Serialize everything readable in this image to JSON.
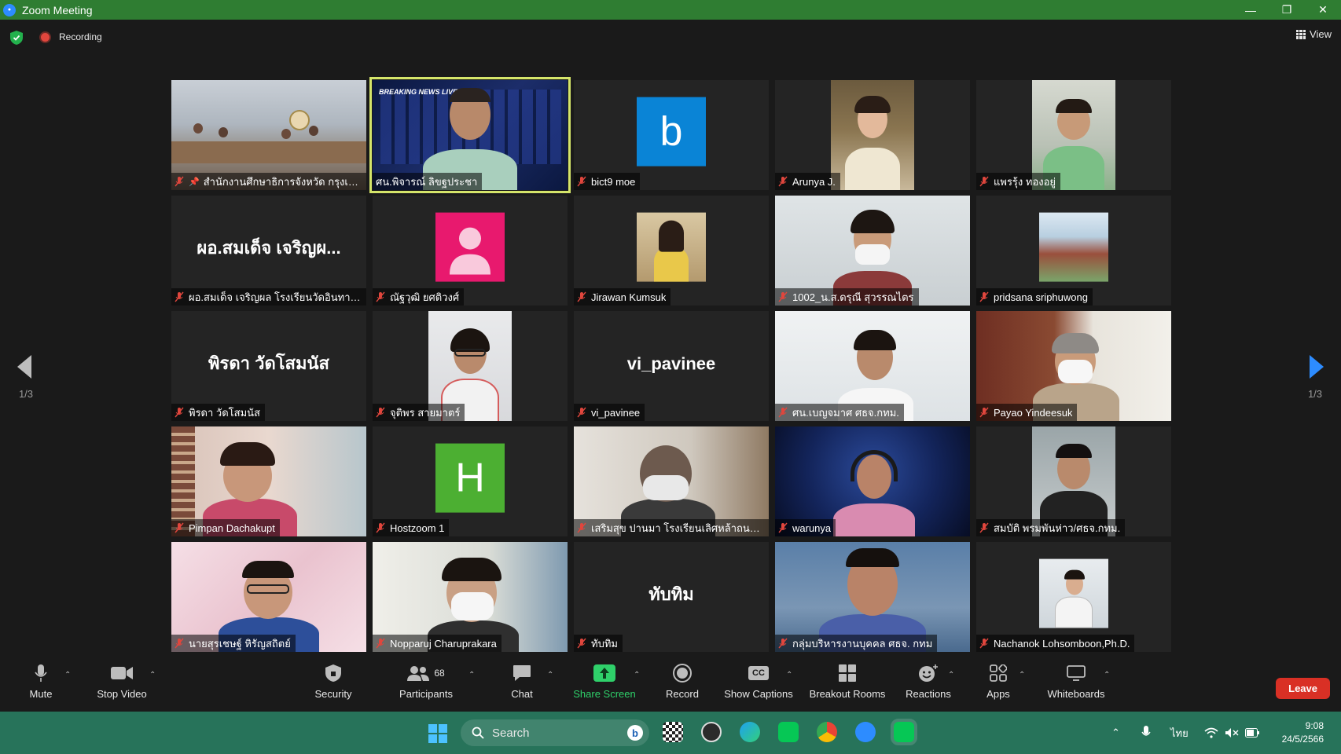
{
  "window": {
    "title": "Zoom Meeting"
  },
  "topbar": {
    "recording_label": "Recording",
    "view_label": "View"
  },
  "pagination": {
    "left_indicator": "1/3",
    "right_indicator": "1/3"
  },
  "tiles": [
    {
      "name": "สำนักงานศึกษาธิการจังหวัด กรุงเทพ...",
      "type": "video",
      "pinned": true
    },
    {
      "name": "ศน.พิจารณ์ ลิขฐประชา",
      "type": "video",
      "active": true,
      "overlay_text": "BREAKING NEWS LIVE"
    },
    {
      "name": "bict9 moe",
      "type": "avatar",
      "avatar_letter": "b",
      "avatar_color": "#0a84d6"
    },
    {
      "name": "Arunya J.",
      "type": "video"
    },
    {
      "name": "แพรรุ้ง ทองอยู่",
      "type": "video"
    },
    {
      "name": "ผอ.สมเด็จ เจริญผล โรงเรียนวัดอินทาราม",
      "type": "text",
      "display_text": "ผอ.สมเด็จ เจริญผ..."
    },
    {
      "name": "ณัฐวุฒิ ยศติวงศ์",
      "type": "avatar-person",
      "avatar_color": "#e8196e"
    },
    {
      "name": "Jirawan Kumsuk",
      "type": "video"
    },
    {
      "name": "1002_น.ส.ดรุณี สุวรรณไตร",
      "type": "video"
    },
    {
      "name": "pridsana sriphuwong",
      "type": "video"
    },
    {
      "name": "พิรดา วัดโสมนัส",
      "type": "text",
      "display_text": "พิรดา วัดโสมนัส"
    },
    {
      "name": "จุติพร สายมาตร์",
      "type": "video"
    },
    {
      "name": "vi_pavinee",
      "type": "text",
      "display_text": "vi_pavinee"
    },
    {
      "name": "ศน.เบญจมาศ ศธจ.กทม.",
      "type": "video"
    },
    {
      "name": "Payao Yindeesuk",
      "type": "video"
    },
    {
      "name": "Pimpan Dachakupt",
      "type": "video"
    },
    {
      "name": "Hostzoom 1",
      "type": "avatar",
      "avatar_letter": "H",
      "avatar_color": "#4caf32"
    },
    {
      "name": "เสริมสุข ปานมา โรงเรียนเลิศหล้าถนนก...",
      "type": "video"
    },
    {
      "name": "warunya",
      "type": "video"
    },
    {
      "name": "สมบัติ พรมพันห่าว/ศธจ.กทม.",
      "type": "video"
    },
    {
      "name": "นายสุรเชษฐ์ หิรัญสถิตย์",
      "type": "video"
    },
    {
      "name": "Nopparuj Charuprakara",
      "type": "video"
    },
    {
      "name": "ทับทิม",
      "type": "text",
      "display_text": "ทับทิม"
    },
    {
      "name": "กลุ่มบริหารงานบุคคล ศธจ. กทม",
      "type": "video"
    },
    {
      "name": "Nachanok Lohsomboon,Ph.D.",
      "type": "video"
    }
  ],
  "toolbar": {
    "mute": "Mute",
    "stop_video": "Stop Video",
    "security": "Security",
    "participants": "Participants",
    "participants_count": "68",
    "chat": "Chat",
    "share_screen": "Share Screen",
    "record": "Record",
    "show_captions": "Show Captions",
    "captions_badge": "CC",
    "breakout_rooms": "Breakout Rooms",
    "reactions": "Reactions",
    "apps": "Apps",
    "whiteboards": "Whiteboards",
    "leave": "Leave"
  },
  "taskbar": {
    "search_placeholder": "Search",
    "tray_lang": "ไทย",
    "time": "9:08",
    "date": "24/5/2566"
  },
  "colors": {
    "titlebar": "#2f7d32",
    "taskbar": "#27735a",
    "leave": "#d93025",
    "share_green": "#2fd06a",
    "active_border": "#d5e56a",
    "muted_red": "#e0463d"
  }
}
